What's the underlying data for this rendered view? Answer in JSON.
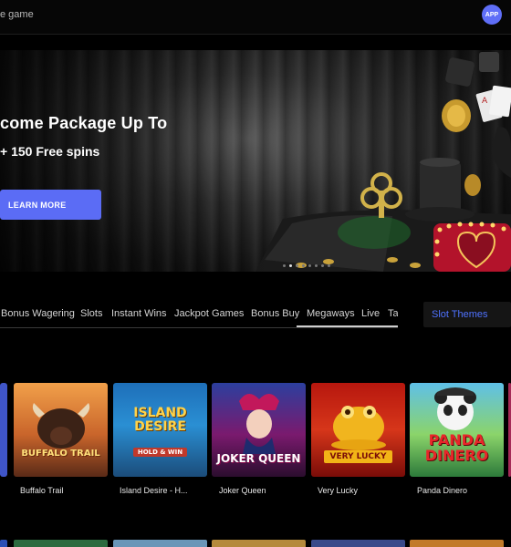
{
  "header": {
    "search_placeholder": "e game",
    "app_label": "APP"
  },
  "hero": {
    "title": "come Package Up To",
    "subtitle": "+ 150 Free spins",
    "cta": "LEARN MORE",
    "slides_total": 8,
    "active_slide": 1
  },
  "categories": {
    "tabs": [
      "Bonus Wagering",
      "Slots",
      "Instant Wins",
      "Jackpot Games",
      "Bonus Buy",
      "Megaways",
      "Live",
      "Ta"
    ],
    "active": "Megaways",
    "themes_label": "Slot Themes"
  },
  "games": [
    {
      "name": "Buffalo Trail",
      "tile_text": "BUFFALO TRAIL"
    },
    {
      "name": "Island Desire - H...",
      "tile_text": "ISLAND DESIRE",
      "tile_sub": "HOLD & WIN"
    },
    {
      "name": "Joker Queen",
      "tile_text": "JOKER QUEEN"
    },
    {
      "name": "Very Lucky",
      "tile_text": "VERY LUCKY"
    },
    {
      "name": "Panda Dinero",
      "tile_text": "PANDA DINERO"
    }
  ],
  "colors": {
    "accent": "#5b6cf5",
    "link": "#4f72ff",
    "background": "#000000"
  }
}
